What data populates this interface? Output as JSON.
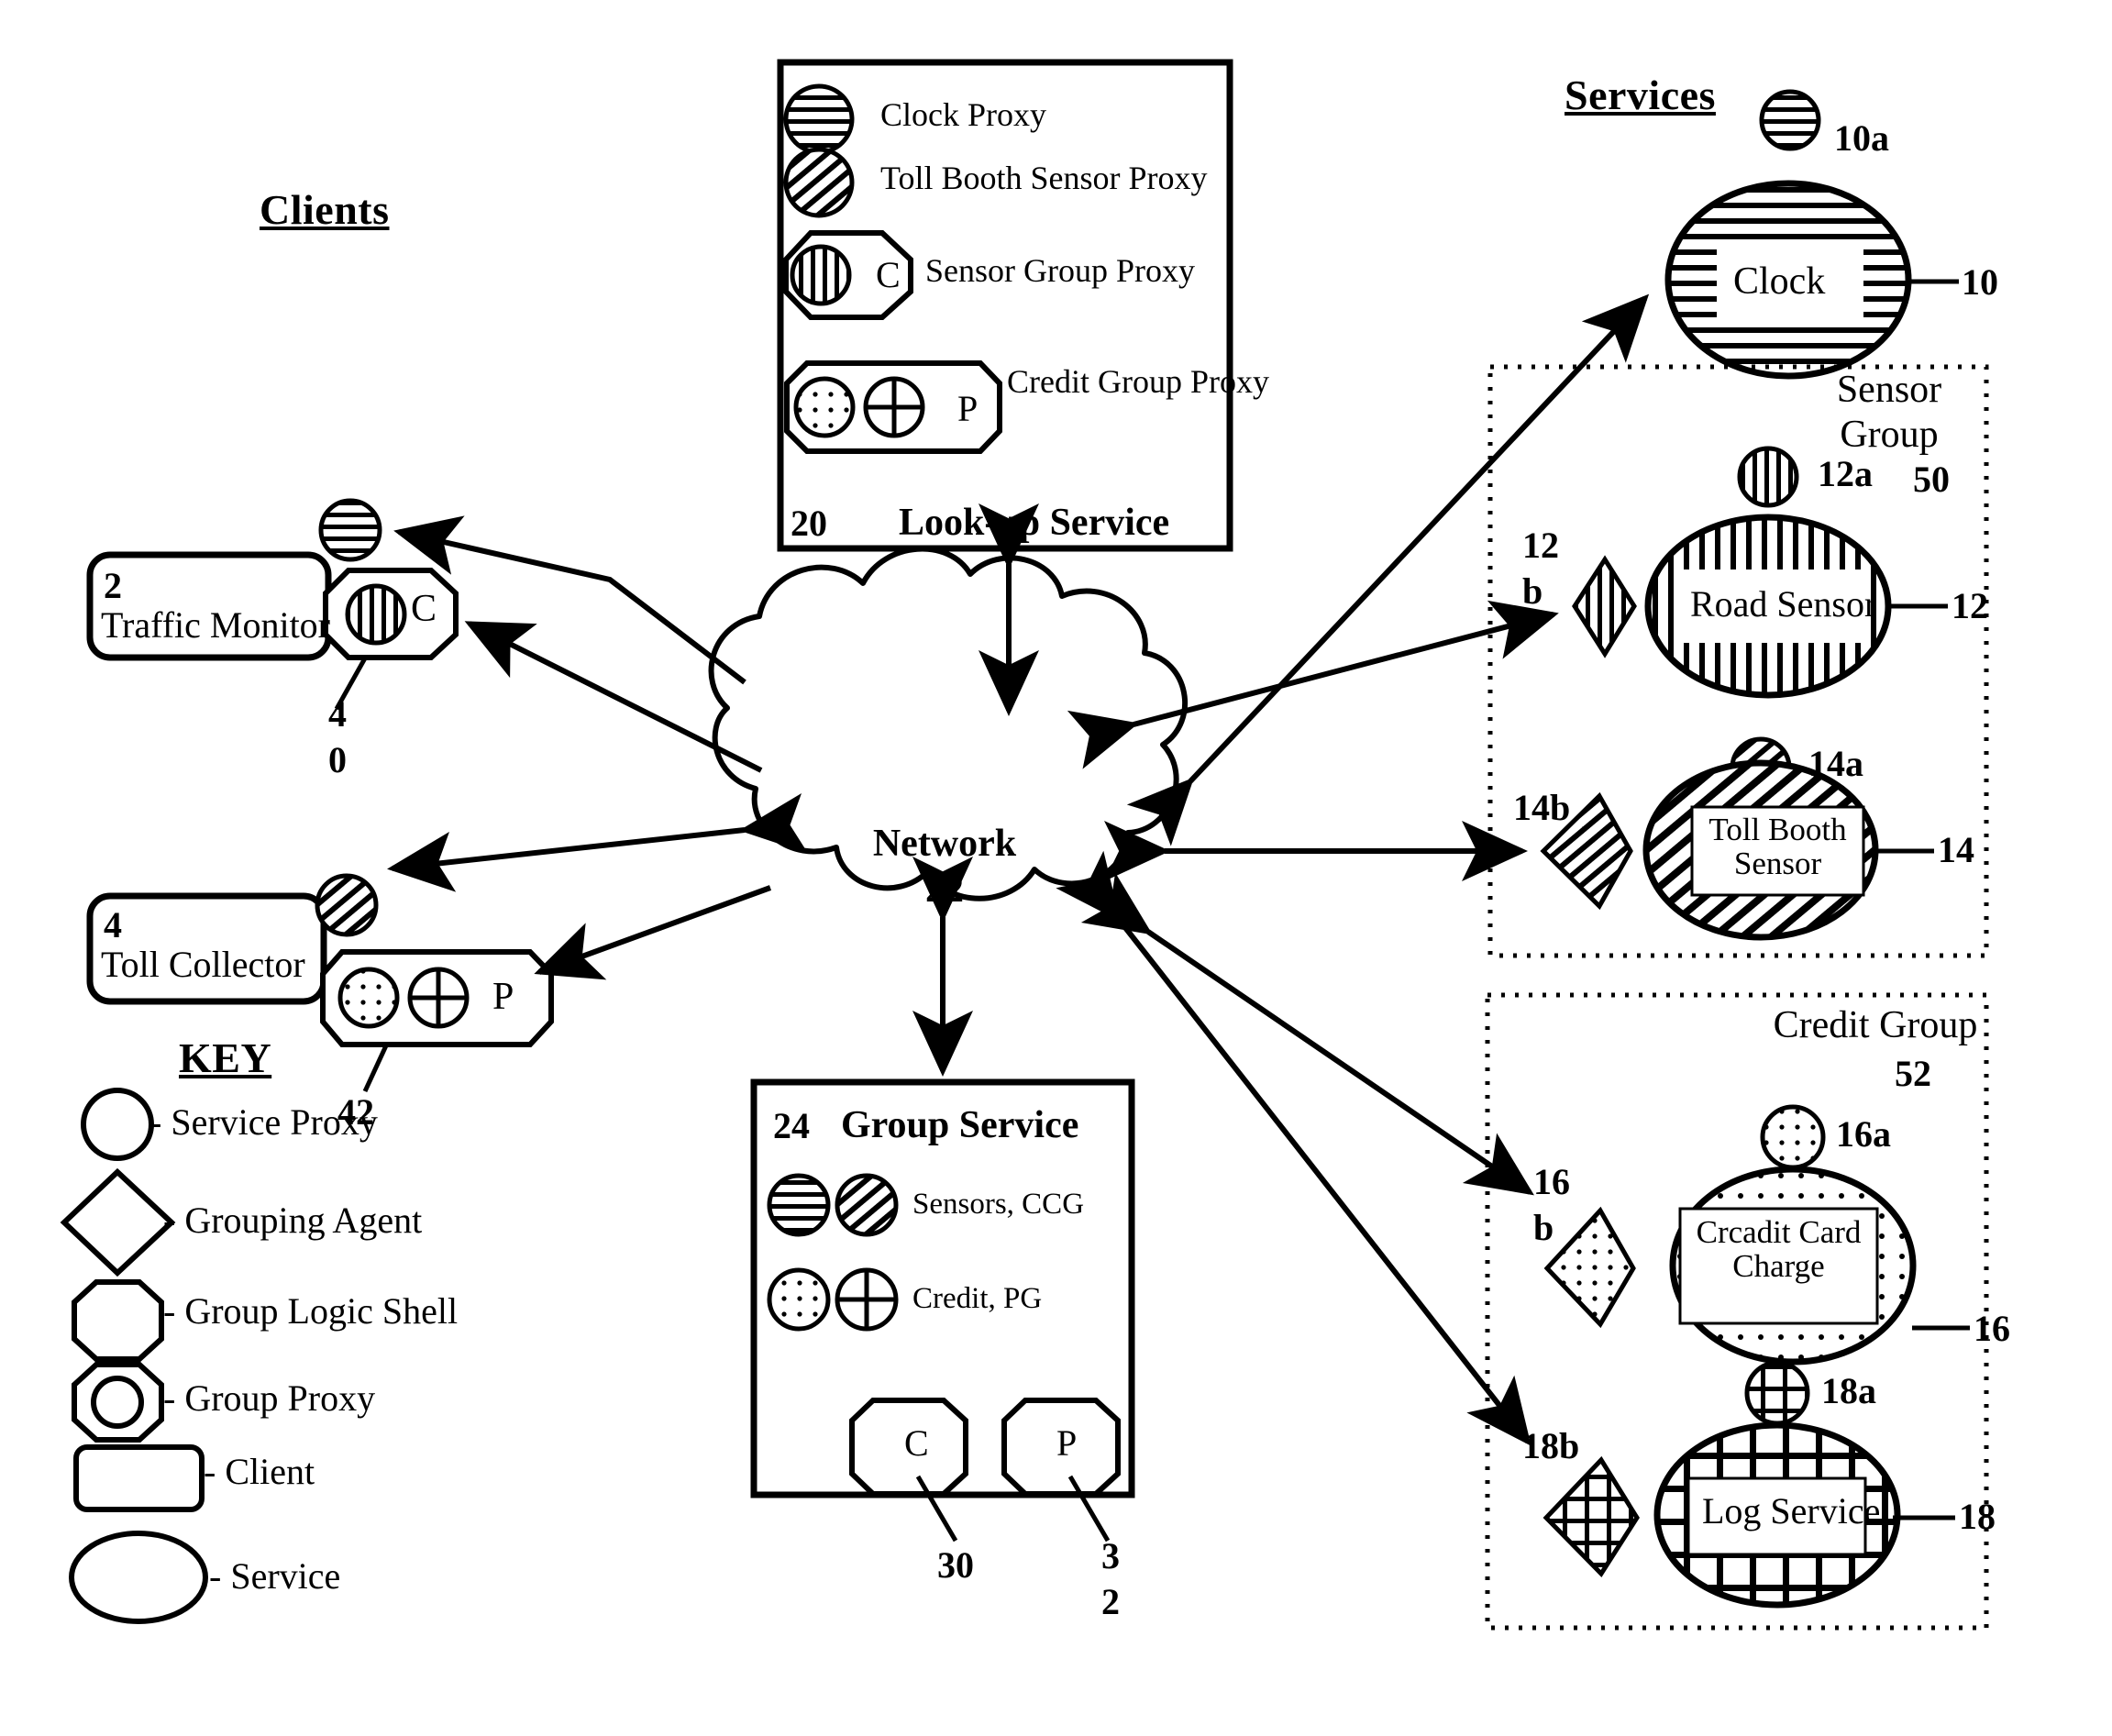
{
  "figure": {
    "sections": {
      "clients_title": "Clients",
      "services_title": "Services",
      "key_title": "KEY"
    },
    "lookup_service": {
      "box_number": "20",
      "box_title": "Look-up Service",
      "entries": [
        {
          "icon": "clock-proxy-circle-horizontal-hatch",
          "label": "Clock Proxy"
        },
        {
          "icon": "toll-booth-sensor-proxy-circle-diagonal-hatch",
          "label": "Toll Booth Sensor Proxy"
        },
        {
          "icon": "sensor-group-proxy-octagon-c",
          "label": "Sensor Group Proxy",
          "badge": "C"
        },
        {
          "icon": "credit-group-proxy-octagon-p",
          "label": "Credit Group Proxy",
          "badge": "P"
        }
      ]
    },
    "group_service": {
      "box_number": "24",
      "box_title": "Group Service",
      "entries": [
        {
          "icons": [
            "circle-horizontal-hatch",
            "circle-diagonal-hatch"
          ],
          "label": "Sensors, CCG"
        },
        {
          "icons": [
            "circle-dotted",
            "circle-cross"
          ],
          "label": "Credit, PG"
        }
      ],
      "shells": [
        {
          "badge": "C",
          "number": "30"
        },
        {
          "badge": "P",
          "number_lines": [
            "3",
            "2"
          ]
        }
      ]
    },
    "network": {
      "label": "Network",
      "number": "22"
    },
    "clients": [
      {
        "number": "2",
        "label": "Traffic Monitor",
        "service_proxy": "clock-proxy-circle-horizontal-hatch",
        "group_shell": {
          "badge": "C",
          "proxy": "circle-vertical-hatch",
          "number_lines": [
            "4",
            "0"
          ]
        }
      },
      {
        "number": "4",
        "label": "Toll Collector",
        "service_proxy": "toll-booth-sensor-proxy-circle-diagonal-hatch",
        "group_shell": {
          "badge": "P",
          "proxies": [
            "circle-dotted",
            "circle-cross"
          ],
          "number": "42"
        }
      }
    ],
    "services": [
      {
        "label": "Clock",
        "number": "10",
        "proxy_number": "10a",
        "fill": "horizontal-hatch",
        "agent": null,
        "group": null
      },
      {
        "label": "Road Sensor",
        "number": "12",
        "proxy_number": "12a",
        "agent_number_lines": [
          "12",
          "b"
        ],
        "fill": "vertical-hatch",
        "group": "sensor-group"
      },
      {
        "label": "Toll Booth\nSensor",
        "number": "14",
        "proxy_number": "14a",
        "agent_number": "14b",
        "fill": "diagonal-hatch",
        "group": "sensor-group"
      },
      {
        "label": "Crcadit Card\nCharge",
        "number": "16",
        "proxy_number": "16a",
        "agent_number_lines": [
          "16",
          "b"
        ],
        "fill": "dotted",
        "group": "credit-group"
      },
      {
        "label": "Log Service",
        "number": "18",
        "proxy_number": "18a",
        "agent_number": "18b",
        "fill": "grid",
        "group": "credit-group"
      }
    ],
    "groups": [
      {
        "name": "Sensor\nGroup",
        "line1": "Sensor",
        "line2": "Group",
        "number": "50"
      },
      {
        "name": "Credit Group",
        "line1": "Credit Group",
        "line2": "",
        "number": "52"
      }
    ],
    "key_items": [
      {
        "shape": "circle",
        "label": "- Service Proxy"
      },
      {
        "shape": "diamond",
        "label": "- Grouping Agent"
      },
      {
        "shape": "octagon",
        "label": "- Group Logic Shell"
      },
      {
        "shape": "octagon-with-circle",
        "label": "- Group Proxy"
      },
      {
        "shape": "rounded-rect",
        "label": "- Client"
      },
      {
        "shape": "ellipse",
        "label": "- Service"
      }
    ]
  },
  "colors": {
    "ink": "#000000",
    "paper": "#ffffff"
  }
}
